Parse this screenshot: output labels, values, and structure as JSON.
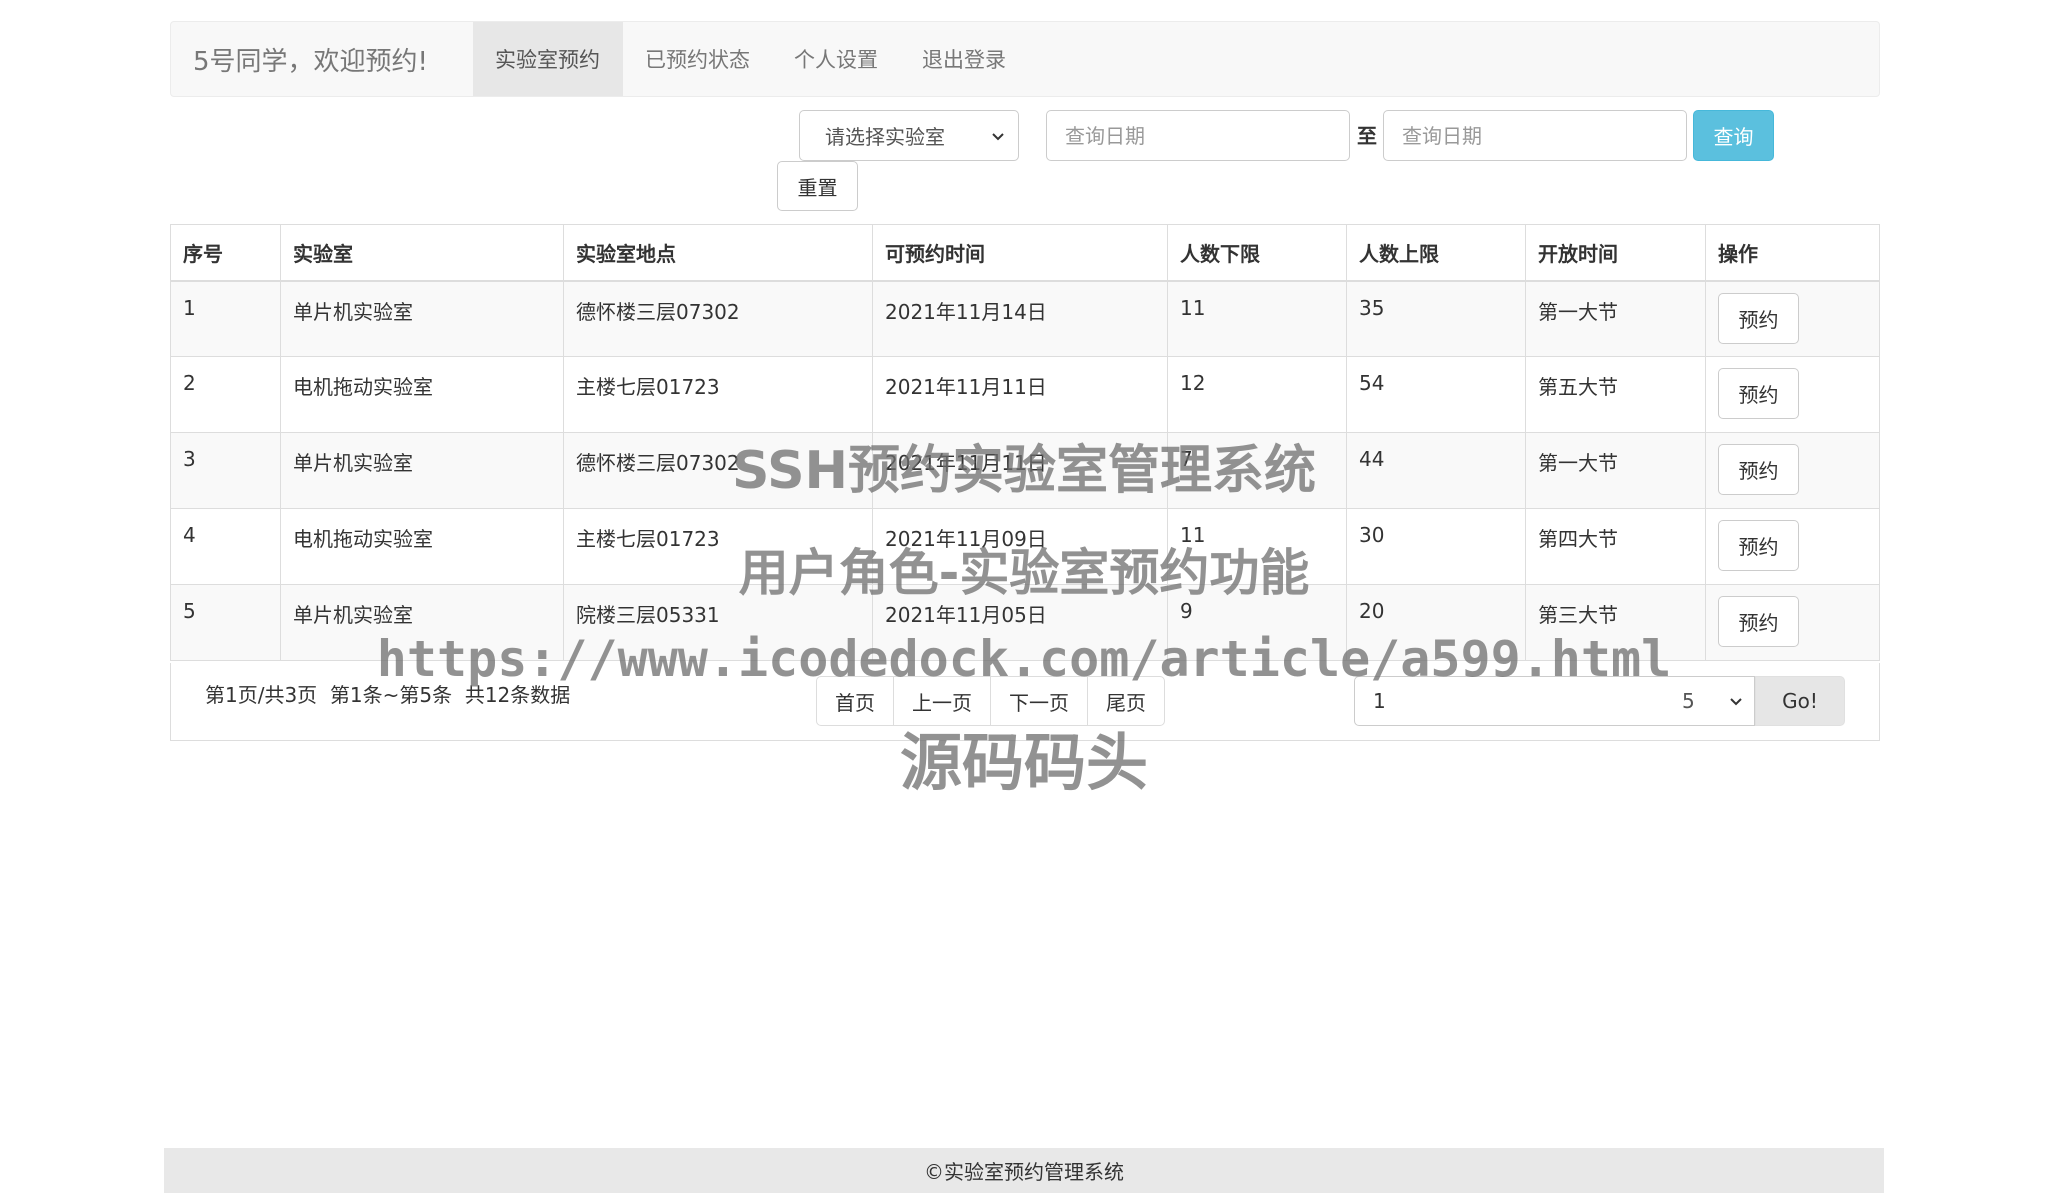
{
  "navbar": {
    "brand": "5号同学，欢迎预约!",
    "items": [
      {
        "label": "实验室预约",
        "active": true
      },
      {
        "label": "已预约状态",
        "active": false
      },
      {
        "label": "个人设置",
        "active": false
      },
      {
        "label": "退出登录",
        "active": false
      }
    ]
  },
  "filter": {
    "lab_select_value": "请选择实验室",
    "date_from_placeholder": "查询日期",
    "to_label": "至",
    "date_to_placeholder": "查询日期",
    "query_label": "查询",
    "reset_label": "重置"
  },
  "table": {
    "headers": [
      "序号",
      "实验室",
      "实验室地点",
      "可预约时间",
      "人数下限",
      "人数上限",
      "开放时间",
      "操作"
    ],
    "rows": [
      {
        "no": "1",
        "lab": "单片机实验室",
        "location": "德怀楼三层07302",
        "date": "2021年11月14日",
        "min": "11",
        "max": "35",
        "open": "第一大节",
        "action": "预约"
      },
      {
        "no": "2",
        "lab": "电机拖动实验室",
        "location": "主楼七层01723",
        "date": "2021年11月11日",
        "min": "12",
        "max": "54",
        "open": "第五大节",
        "action": "预约"
      },
      {
        "no": "3",
        "lab": "单片机实验室",
        "location": "德怀楼三层07302",
        "date": "2021年11月11日",
        "min": "7",
        "max": "44",
        "open": "第一大节",
        "action": "预约"
      },
      {
        "no": "4",
        "lab": "电机拖动实验室",
        "location": "主楼七层01723",
        "date": "2021年11月09日",
        "min": "11",
        "max": "30",
        "open": "第四大节",
        "action": "预约"
      },
      {
        "no": "5",
        "lab": "单片机实验室",
        "location": "院楼三层05331",
        "date": "2021年11月05日",
        "min": "9",
        "max": "20",
        "open": "第三大节",
        "action": "预约"
      }
    ]
  },
  "pagination": {
    "info": "第1页/共3页  第1条~第5条  共12条数据",
    "first": "首页",
    "prev": "上一页",
    "next": "下一页",
    "last": "尾页",
    "goto_value": "1",
    "page_size": "5",
    "go_label": "Go!"
  },
  "watermark": {
    "line1": "SSH预约实验室管理系统",
    "line2": "用户角色-实验室预约功能",
    "line3": "https://www.icodedock.com/article/a599.html",
    "line4": "源码码头"
  },
  "footer": {
    "text": "©实验室预约管理系统"
  },
  "colors": {
    "query_button": "#5bc0de",
    "navbar_bg": "#f8f8f8",
    "active_nav_bg": "#e7e7e7"
  }
}
